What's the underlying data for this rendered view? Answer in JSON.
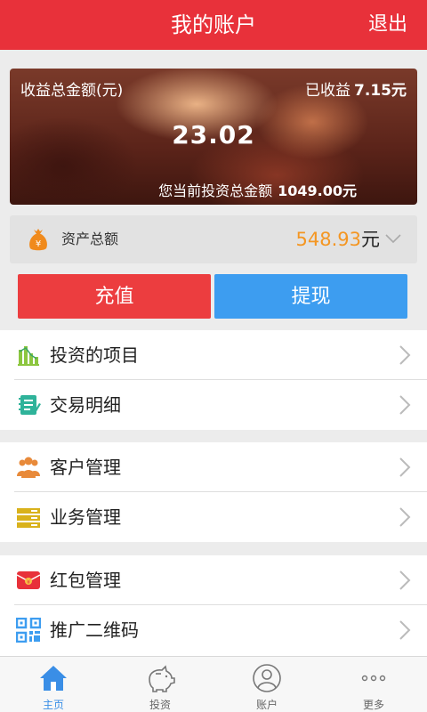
{
  "header": {
    "title": "我的账户",
    "logout": "退出"
  },
  "banner": {
    "total_label": "收益总金额(元)",
    "earned_label": "已收益",
    "earned_value": "7.15元",
    "amount": "23.02",
    "invest_label": "您当前投资总金额",
    "invest_value": "1049.00元"
  },
  "assets": {
    "label": "资产总额",
    "value": "548.93",
    "unit": "元",
    "icon": "money-bag-icon"
  },
  "actions": {
    "recharge": "充值",
    "withdraw": "提现"
  },
  "menu": [
    {
      "label": "投资的项目",
      "icon": "bar-chart-icon"
    },
    {
      "label": "交易明细",
      "icon": "notepad-icon"
    },
    {
      "label": "客户管理",
      "icon": "people-icon"
    },
    {
      "label": "业务管理",
      "icon": "stack-icon"
    },
    {
      "label": "红包管理",
      "icon": "red-envelope-icon"
    },
    {
      "label": "推广二维码",
      "icon": "qr-code-icon"
    }
  ],
  "tabs": [
    {
      "label": "主页",
      "icon": "home-icon",
      "active": true
    },
    {
      "label": "投资",
      "icon": "piggy-bank-icon",
      "active": false
    },
    {
      "label": "账户",
      "icon": "user-icon",
      "active": false
    },
    {
      "label": "更多",
      "icon": "more-icon",
      "active": false
    }
  ],
  "colors": {
    "header": "#e8313a",
    "accent_orange": "#f49622",
    "recharge": "#ec3d3f",
    "withdraw": "#3d9df0",
    "tab_active": "#3a8ee6"
  }
}
